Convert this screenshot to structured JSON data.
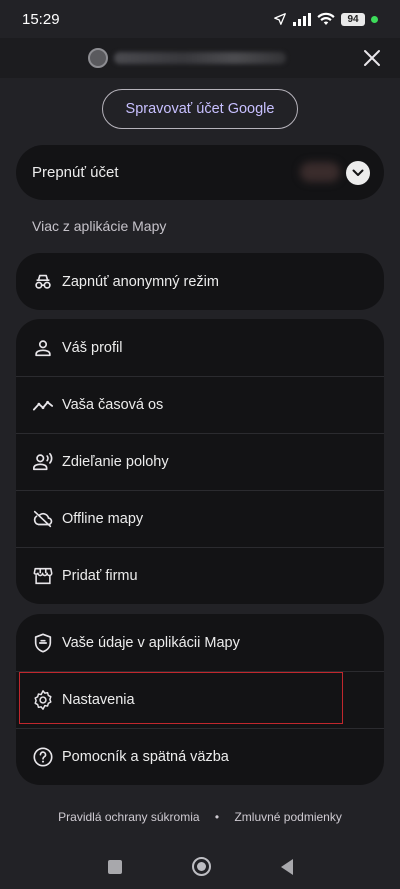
{
  "status_bar": {
    "time": "15:29",
    "battery": "94"
  },
  "header": {
    "manage_account_label": "Spravovať účet Google"
  },
  "switch_account": {
    "label": "Prepnúť účet"
  },
  "section": {
    "label": "Viac z aplikácie Mapy"
  },
  "incognito_card": {
    "label": "Zapnúť anonymný režim",
    "icon": "incognito-icon"
  },
  "main_menu": [
    {
      "label": "Váš profil",
      "icon": "person-icon"
    },
    {
      "label": "Vaša časová os",
      "icon": "timeline-icon"
    },
    {
      "label": "Zdieľanie polohy",
      "icon": "location-sharing-icon"
    },
    {
      "label": "Offline mapy",
      "icon": "cloud-off-icon"
    },
    {
      "label": "Pridať firmu",
      "icon": "storefront-icon"
    }
  ],
  "settings_menu": [
    {
      "label": "Vaše údaje v aplikácii Mapy",
      "icon": "shield-data-icon"
    },
    {
      "label": "Nastavenia",
      "icon": "gear-icon"
    },
    {
      "label": "Pomocník a spätná väzba",
      "icon": "help-icon"
    }
  ],
  "footer": {
    "privacy_label": "Pravidlá ochrany súkromia",
    "separator": "•",
    "terms_label": "Zmluvné podmienky"
  },
  "colors": {
    "background": "#222226",
    "card": "#131315",
    "accent_text": "#c8c0ff",
    "highlight": "#c1272d"
  }
}
